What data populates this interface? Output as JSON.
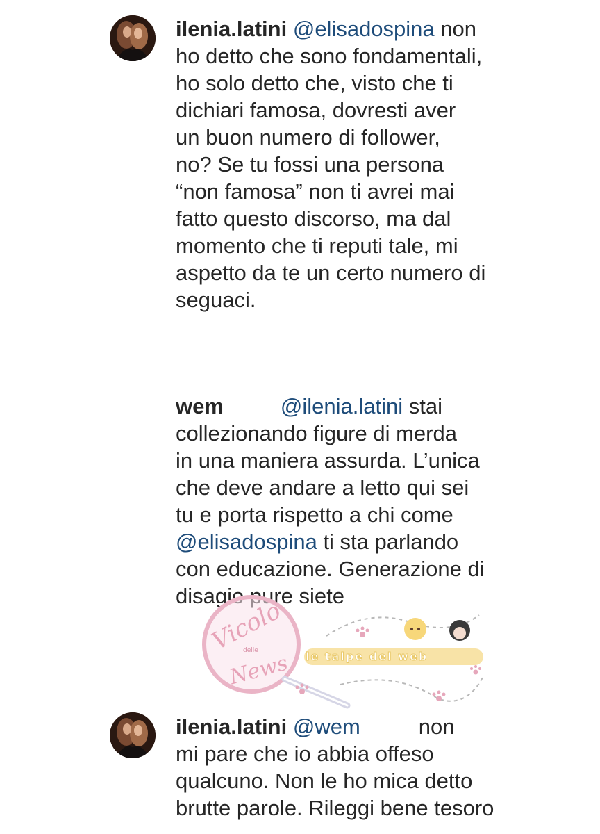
{
  "comments": [
    {
      "username": "ilenia.latini",
      "lines": [
        {
          "mention": "@elisadospina",
          "text": " non"
        },
        {
          "text": "ho detto che sono fondamentali,"
        },
        {
          "text": "ho solo detto che, visto che ti"
        },
        {
          "text": "dichiari famosa, dovresti aver"
        },
        {
          "text": "un buon numero di follower,"
        },
        {
          "text": "no? Se tu fossi una persona"
        },
        {
          "text": "“non famosa”  non ti avrei mai"
        },
        {
          "text": "fatto questo discorso, ma dal"
        },
        {
          "text": "momento che ti reputi tale, mi"
        },
        {
          "text": "aspetto da te un certo numero di"
        },
        {
          "text": "seguaci."
        }
      ]
    },
    {
      "username": "wem",
      "first_mention": "@ilenia.latini",
      "first_text": " stai",
      "lines": [
        {
          "text": "collezionando figure di merda"
        },
        {
          "text": "in una maniera assurda. L’unica"
        },
        {
          "text": "che deve andare a letto qui sei"
        },
        {
          "text": "tu e porta rispetto a chi come"
        },
        {
          "mention": "@elisadospina",
          "text": " ti sta parlando"
        },
        {
          "text": "con educazione. Generazione di"
        },
        {
          "text": "disagio pure siete"
        }
      ]
    },
    {
      "username": "ilenia.latini",
      "first_mention": "@wem",
      "first_text": "non",
      "lines": [
        {
          "text": "mi pare che io abbia offeso"
        },
        {
          "text": "qualcuno. Non le ho mica detto"
        },
        {
          "text": "brutte parole. Rileggi bene tesoro"
        }
      ]
    }
  ],
  "watermark": {
    "logo_word_1": "Vicolo",
    "logo_word_2": "delle",
    "logo_word_3": "News",
    "banner": "le talpe del web"
  },
  "colors": {
    "text": "#262626",
    "mention": "#1e4c7a",
    "watermark_pink": "#e7a3b8"
  },
  "icons": [
    "avatar",
    "magnifier-icon",
    "paw-icon",
    "cartoon-face-icon"
  ]
}
